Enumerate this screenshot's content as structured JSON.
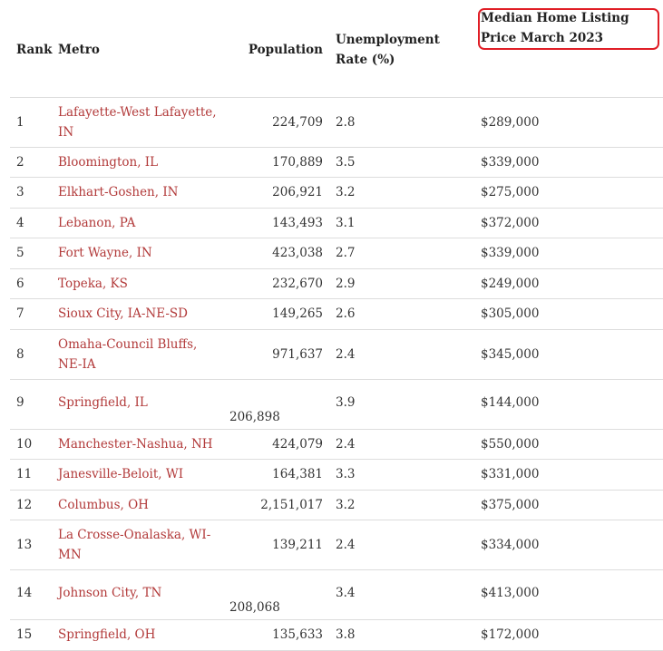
{
  "table": {
    "columns": {
      "rank": "Rank",
      "metro": "Metro",
      "population": "Population",
      "unemployment": "Unemployment Rate (%)",
      "price": "Median Home Listing Price March 2023"
    },
    "highlight_color": "#e01e26",
    "link_color": "#b23a3a",
    "rows": [
      {
        "rank": "1",
        "metro": "Lafayette-West Lafayette, IN",
        "population": "224,709",
        "unemployment": "2.8",
        "price": "$289,000"
      },
      {
        "rank": "2",
        "metro": "Bloomington, IL",
        "population": "170,889",
        "unemployment": "3.5",
        "price": "$339,000"
      },
      {
        "rank": "3",
        "metro": "Elkhart-Goshen, IN",
        "population": "206,921",
        "unemployment": "3.2",
        "price": "$275,000"
      },
      {
        "rank": "4",
        "metro": "Lebanon, PA",
        "population": "143,493",
        "unemployment": "3.1",
        "price": "$372,000"
      },
      {
        "rank": "5",
        "metro": "Fort Wayne, IN",
        "population": "423,038",
        "unemployment": "2.7",
        "price": "$339,000"
      },
      {
        "rank": "6",
        "metro": "Topeka, KS",
        "population": "232,670",
        "unemployment": "2.9",
        "price": "$249,000"
      },
      {
        "rank": "7",
        "metro": "Sioux City, IA-NE-SD",
        "population": "149,265",
        "unemployment": "2.6",
        "price": "$305,000"
      },
      {
        "rank": "8",
        "metro": "Omaha-Council Bluffs, NE-IA",
        "population": "971,637",
        "unemployment": "2.4",
        "price": "$345,000"
      },
      {
        "rank": "9",
        "metro": "Springfield, IL",
        "population": "206,898",
        "unemployment": "3.9",
        "price": "$144,000"
      },
      {
        "rank": "10",
        "metro": "Manchester-Nashua, NH",
        "population": "424,079",
        "unemployment": "2.4",
        "price": "$550,000"
      },
      {
        "rank": "11",
        "metro": "Janesville-Beloit, WI",
        "population": "164,381",
        "unemployment": "3.3",
        "price": "$331,000"
      },
      {
        "rank": "12",
        "metro": "Columbus, OH",
        "population": "2,151,017",
        "unemployment": "3.2",
        "price": "$375,000"
      },
      {
        "rank": "13",
        "metro": "La Crosse-Onalaska, WI-MN",
        "population": "139,211",
        "unemployment": "2.4",
        "price": "$334,000"
      },
      {
        "rank": "14",
        "metro": "Johnson City, TN",
        "population": "208,068",
        "unemployment": "3.4",
        "price": "$413,000"
      },
      {
        "rank": "15",
        "metro": "Springfield, OH",
        "population": "135,633",
        "unemployment": "3.8",
        "price": "$172,000"
      }
    ]
  }
}
